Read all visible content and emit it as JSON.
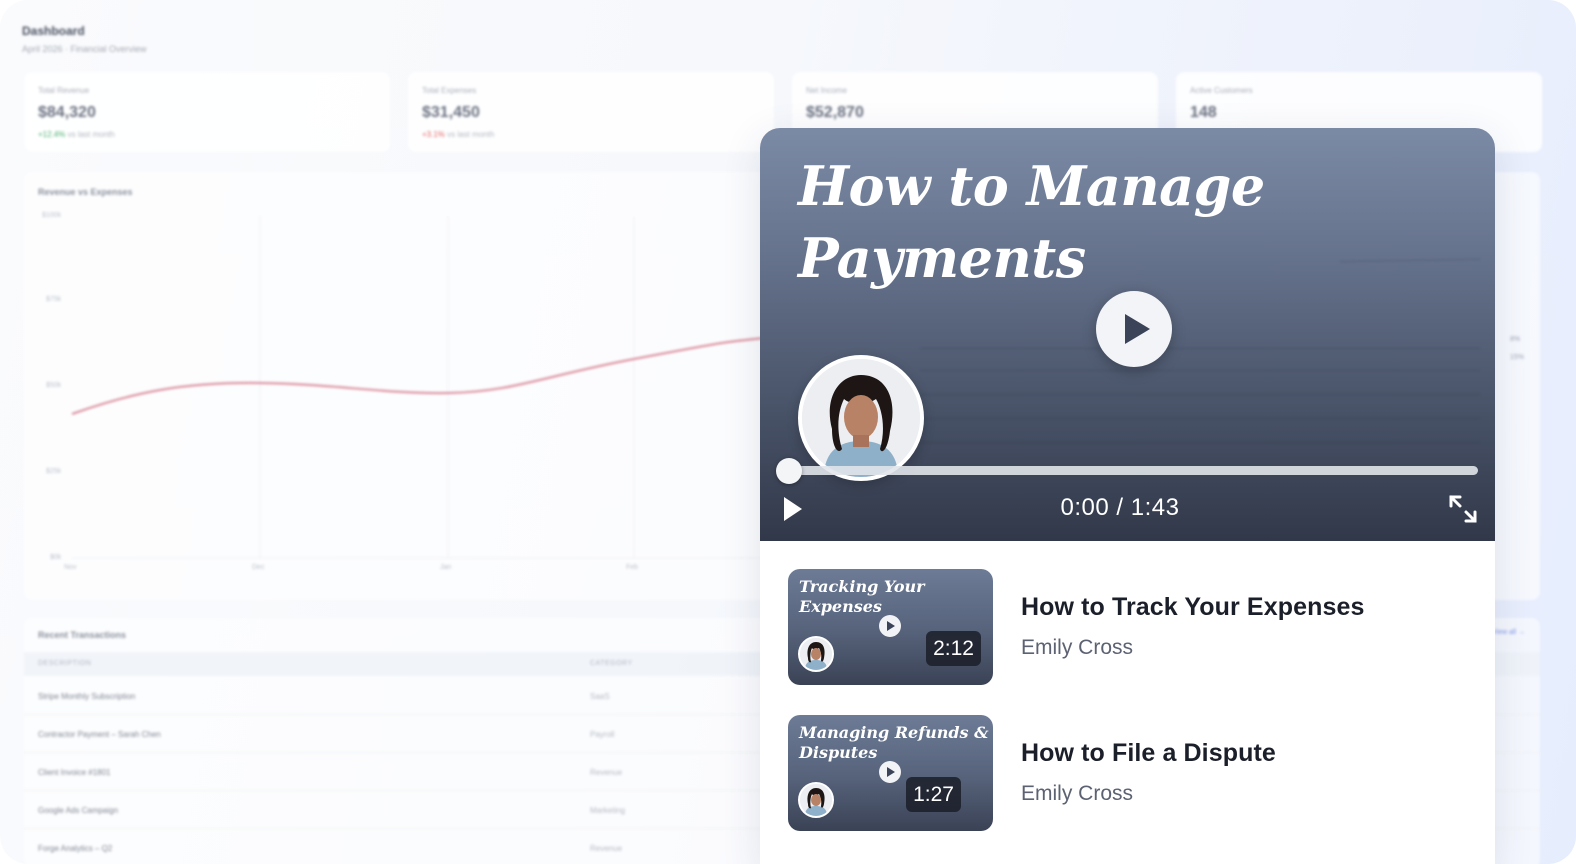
{
  "dashboard": {
    "title": "Dashboard",
    "subtitle": "April 2026 · Financial Overview",
    "stats": [
      {
        "label": "Total Revenue",
        "value": "$84,320",
        "change": "+12.4%",
        "change_dir": "up",
        "note": "vs last month"
      },
      {
        "label": "Total Expenses",
        "value": "$31,450",
        "change": "+3.1%",
        "change_dir": "down",
        "note": "vs last month"
      },
      {
        "label": "Net Income",
        "value": "$52,870",
        "change": "",
        "change_dir": "",
        "note": ""
      },
      {
        "label": "Active Customers",
        "value": "148",
        "change": "",
        "change_dir": "",
        "note": ""
      }
    ],
    "chart": {
      "title": "Revenue vs Expenses",
      "y_ticks": [
        "$100k",
        "$75k",
        "$50k",
        "$25k",
        "$0k"
      ],
      "x_ticks": [
        "Nov",
        "Dec",
        "Jan",
        "Feb"
      ]
    },
    "side_percents": [
      "8%",
      "15%"
    ],
    "transactions": {
      "title": "Recent Transactions",
      "see_all": "View all →",
      "columns": [
        "DESCRIPTION",
        "CATEGORY"
      ],
      "rows": [
        {
          "description": "Stripe Monthly Subscription",
          "category": "SaaS"
        },
        {
          "description": "Contractor Payment – Sarah Chen",
          "category": "Payroll"
        },
        {
          "description": "Client Invoice #1801",
          "category": "Revenue"
        },
        {
          "description": "Google Ads Campaign",
          "category": "Marketing"
        },
        {
          "description": "Forge Analytics – Q2",
          "category": "Revenue"
        }
      ]
    }
  },
  "player": {
    "title": "How to Manage Payments",
    "current_time": "0:00",
    "duration": "1:43",
    "time_display": "0:00 / 1:43",
    "progress": 0.0,
    "icons": {
      "play": "play-icon",
      "big_play": "play-circle-icon",
      "fullscreen": "fullscreen-icon"
    }
  },
  "related": [
    {
      "thumb_title": "Tracking Your Expenses",
      "duration": "2:12",
      "title": "How to Track Your Expenses",
      "author": "Emily Cross"
    },
    {
      "thumb_title": "Managing Refunds & Disputes",
      "duration": "1:27",
      "title": "How to File a Dispute",
      "author": "Emily Cross"
    }
  ],
  "colors": {
    "accent_red_line": "#d98a9a",
    "player_bg_top": "#7b8aa5",
    "player_bg_bottom": "#313849",
    "text_dark": "#1b1f29",
    "text_muted": "#5c6272"
  }
}
